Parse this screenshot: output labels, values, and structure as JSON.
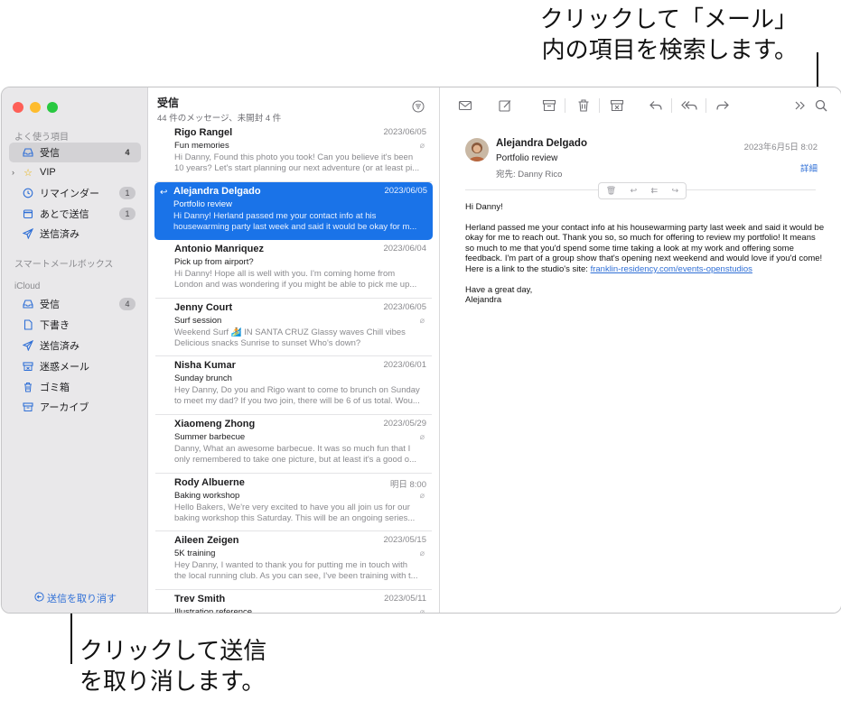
{
  "callouts": {
    "top_line1": "クリックして「メール」",
    "top_line2": "内の項目を検索します。",
    "bottom_line1": "クリックして送信",
    "bottom_line2": "を取り消します。"
  },
  "colors": {
    "accent": "#1a73e8",
    "traffic_red": "#fe5f57",
    "traffic_yellow": "#febc2e",
    "traffic_green": "#28c840"
  },
  "sidebar": {
    "favorites_header": "よく使う項目",
    "favorites": [
      {
        "icon": "inbox-icon",
        "label": "受信",
        "count": "4",
        "selected": true
      },
      {
        "icon": "star-icon",
        "label": "VIP",
        "count": ""
      },
      {
        "icon": "clock-icon",
        "label": "リマインダー",
        "count": "1"
      },
      {
        "icon": "calendar-icon",
        "label": "あとで送信",
        "count": "1"
      },
      {
        "icon": "paperplane-icon",
        "label": "送信済み",
        "count": ""
      }
    ],
    "smart_header": "スマートメールボックス",
    "icloud_header": "iCloud",
    "icloud": [
      {
        "icon": "inbox-icon",
        "label": "受信",
        "count": "4"
      },
      {
        "icon": "document-icon",
        "label": "下書き",
        "count": ""
      },
      {
        "icon": "paperplane-icon",
        "label": "送信済み",
        "count": ""
      },
      {
        "icon": "junk-icon",
        "label": "迷惑メール",
        "count": ""
      },
      {
        "icon": "trash-icon",
        "label": "ゴミ箱",
        "count": ""
      },
      {
        "icon": "archive-icon",
        "label": "アーカイブ",
        "count": ""
      }
    ],
    "undo_send": "送信を取り消す"
  },
  "list": {
    "title": "受信",
    "subtitle": "44 件のメッセージ、未開封 4 件",
    "messages": [
      {
        "from": "Rigo Rangel",
        "date": "2023/06/05",
        "subject": "Fun memories",
        "preview1": "Hi Danny, Found this photo you took! Can you believe it's been",
        "preview2": "10 years? Let's start planning our next adventure (or at least pi..."
      },
      {
        "from": "Alejandra Delgado",
        "date": "2023/06/05",
        "subject": "Portfolio review",
        "preview1": "Hi Danny! Herland passed me your contact info at his",
        "preview2": "housewarming party last week and said it would be okay for m..."
      },
      {
        "from": "Antonio Manriquez",
        "date": "2023/06/04",
        "subject": "Pick up from airport?",
        "preview1": "Hi Danny! Hope all is well with you. I'm coming home from",
        "preview2": "London and was wondering if you might be able to pick me up..."
      },
      {
        "from": "Jenny Court",
        "date": "2023/06/05",
        "subject": "Surf session",
        "preview1": "Weekend Surf 🏄 IN SANTA CRUZ Glassy waves Chill vibes",
        "preview2": "Delicious snacks Sunrise to sunset Who's down?"
      },
      {
        "from": "Nisha Kumar",
        "date": "2023/06/01",
        "subject": "Sunday brunch",
        "preview1": "Hey Danny, Do you and Rigo want to come to brunch on Sunday",
        "preview2": "to meet my dad? If you two join, there will be 6 of us total. Wou..."
      },
      {
        "from": "Xiaomeng Zhong",
        "date": "2023/05/29",
        "subject": "Summer barbecue",
        "preview1": "Danny, What an awesome barbecue. It was so much fun that I",
        "preview2": "only remembered to take one picture, but at least it's a good o..."
      },
      {
        "from": "Rody Albuerne",
        "date": "明日 8:00",
        "subject": "Baking workshop",
        "preview1": "Hello Bakers, We're very excited to have you all join us for our",
        "preview2": "baking workshop this Saturday. This will be an ongoing series..."
      },
      {
        "from": "Aileen Zeigen",
        "date": "2023/05/15",
        "subject": "5K training",
        "preview1": "Hey Danny, I wanted to thank you for putting me in touch with",
        "preview2": "the local running club. As you can see, I've been training with t..."
      },
      {
        "from": "Trev Smith",
        "date": "2023/05/11",
        "subject": "Illustration reference",
        "preview1": "",
        "preview2": ""
      }
    ]
  },
  "reader": {
    "toolbar": [
      "envelope-icon",
      "compose-icon",
      "archive-icon",
      "trash-icon",
      "junk-icon",
      "reply-icon",
      "reply-all-icon",
      "forward-icon",
      "more-icon",
      "search-icon"
    ],
    "sender": "Alejandra Delgado",
    "subject": "Portfolio review",
    "to": "宛先:   Danny Rico",
    "date": "2023年6月5日 8:02",
    "details": "詳細",
    "greeting": "Hi Danny!",
    "body": "Herland passed me your contact info at his housewarming party last week and said it would be okay for me to reach out. Thank you so, so much for offering to review my portfolio! It means so much to me that you'd spend some time taking a look at my work and offering some feedback. I'm part of a group show that's opening next weekend and would love if you'd come! Here is a link to the studio's site:",
    "link": "franklin-residency.com/events-openstudios",
    "closing1": "Have a great day,",
    "closing2": "Alejandra"
  }
}
